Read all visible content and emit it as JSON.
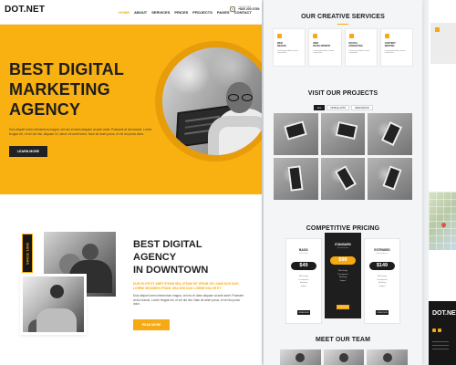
{
  "left_page": {
    "logo": "DOT.NET",
    "nav_items": [
      "HOME",
      "ABOUT",
      "SERVICES",
      "PRICES",
      "PROJECTS",
      "PAGES",
      "CONTACT"
    ],
    "phone": {
      "label": "CALL ANYTIME",
      "number": "+800 200 0789"
    },
    "hero": {
      "title": "BEST DIGITAL\nMARKETING\nAGENCY",
      "description": "Duis aliquet lorem elementum magna, vel nec et diam aliquam at ante amet. Praesent at dui mauris. Lorem feugiat vel, et vel dui nisi, aliquam id, rutrum sit amet tortor. Nam sit amet purus, et vel dui porta dolor.",
      "button_label": "LEARN MORE"
    },
    "about": {
      "since_label": "SINCE 1990",
      "title": "BEST DIGITAL AGENCY\nIN DOWNTOWN",
      "highlight": "DUIS ELITR ET AMET IPSUM SEA. IPSUM SIT IPSUM VEL DIAM DUO DUO. LOREM SEDDIRES IPSUM. SEA SED DUO LOREM DOLOR ET.",
      "description": "Duis aliquet lorem elementum magna, vel nec et diam aliquam at ante amet. Praesent at dui mauris. Lorem feugiat vel, et vel dui nisi. Nam sit amet purus, et vel dui porta dolor.",
      "button_label": "READ MORE"
    }
  },
  "middle_page": {
    "services_title": "OUR CREATIVE SERVICES",
    "services": [
      {
        "title": "WEB\nDESIGN",
        "text": "Lorem ipsum dolor sit amet consectetur."
      },
      {
        "title": "WEB\nDEVELOPMENT",
        "text": "Lorem ipsum dolor sit amet consectetur."
      },
      {
        "title": "DIGITAL\nMARKETING",
        "text": "Lorem ipsum dolor sit amet consectetur."
      },
      {
        "title": "CONTENT\nWRITING",
        "text": "Lorem ipsum dolor sit amet consectetur."
      }
    ],
    "projects_title": "VISIT OUR PROJECTS",
    "project_filters": [
      "ALL",
      "MOBILE APPS",
      "WEB DESIGN"
    ],
    "pricing_title": "COMPETITIVE PRICING",
    "plans": [
      {
        "name": "BASIC",
        "subtitle": "Basic plan",
        "price": "$49",
        "features": [
          "Web Design",
          "Development",
          "Marketing",
          "Support"
        ],
        "button_label": "ORDER NOW"
      },
      {
        "name": "STANDARD",
        "subtitle": "Standard plan",
        "price": "$99",
        "features": [
          "Web Design",
          "Development",
          "Marketing",
          "Support"
        ],
        "button_label": "ORDER NOW"
      },
      {
        "name": "EXTENDED",
        "subtitle": "Extended plan",
        "price": "$149",
        "features": [
          "Web Design",
          "Development",
          "Marketing",
          "Support"
        ],
        "button_label": "ORDER NOW"
      }
    ],
    "team_title": "MEET OUR TEAM"
  },
  "right_page": {
    "footer_logo": "DOT.NET"
  },
  "colors": {
    "accent": "#f7a911",
    "hero_bg": "#f9b011",
    "dark": "#1e1e1e",
    "light_bg": "#f4f5f7"
  }
}
